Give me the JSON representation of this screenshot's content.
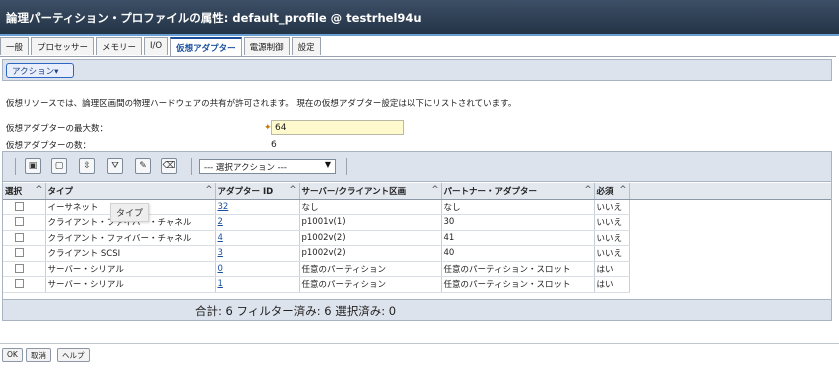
{
  "window": {
    "title": "論理パーティション・プロファイルの属性: default_profile @ testrhel94u"
  },
  "tabs": [
    {
      "label": "一般"
    },
    {
      "label": "プロセッサー"
    },
    {
      "label": "メモリー"
    },
    {
      "label": "I/O"
    },
    {
      "label": "仮想アダプター",
      "active": true
    },
    {
      "label": "電源制御"
    },
    {
      "label": "設定"
    }
  ],
  "action_menu": {
    "label": "アクション▾"
  },
  "description": "仮想リソースでは、論理区画間の物理ハードウェアの共有が許可されます。 現在の仮想アダプター設定は以下にリストされています。",
  "max_adapters": {
    "label": "仮想アダプターの最大数：",
    "value": "64"
  },
  "adapter_count": {
    "label": "仮想アダプターの数：",
    "value": "6"
  },
  "toolbar": {
    "select_action": "--- 選択アクション ---",
    "icons": [
      "select-all-icon",
      "deselect-all-icon",
      "expand-icon",
      "filter-icon",
      "edit-icon",
      "clear-filter-icon"
    ]
  },
  "table": {
    "columns": [
      {
        "label": "選択"
      },
      {
        "label": "タイプ"
      },
      {
        "label": "アダプター ID"
      },
      {
        "label": "サーバー/クライアント区画"
      },
      {
        "label": "パートナー・アダプター"
      },
      {
        "label": "必須"
      }
    ],
    "rows": [
      {
        "type": "イーサネット",
        "id": "32",
        "partition": "なし",
        "partner": "なし",
        "required": "いいえ"
      },
      {
        "type": "クライアント・ファイバー・チャネル",
        "id": "2",
        "partition": "p1001v(1)",
        "partner": "30",
        "required": "いいえ"
      },
      {
        "type": "クライアント・ファイバー・チャネル",
        "id": "4",
        "partition": "p1002v(2)",
        "partner": "41",
        "required": "いいえ"
      },
      {
        "type": "クライアント SCSI",
        "id": "3",
        "partition": "p1002v(2)",
        "partner": "40",
        "required": "いいえ"
      },
      {
        "type": "サーバー・シリアル",
        "id": "0",
        "partition": "任意のパーティション",
        "partner": "任意のパーティション・スロット",
        "required": "はい"
      },
      {
        "type": "サーバー・シリアル",
        "id": "1",
        "partition": "任意のパーティション",
        "partner": "任意のパーティション・スロット",
        "required": "はい"
      }
    ],
    "tooltip": "タイプ",
    "footer": "合計: 6   フィルター済み: 6   選択済み: 0"
  },
  "buttons": {
    "ok": "OK",
    "cancel": "取消",
    "help": "ヘルプ"
  }
}
